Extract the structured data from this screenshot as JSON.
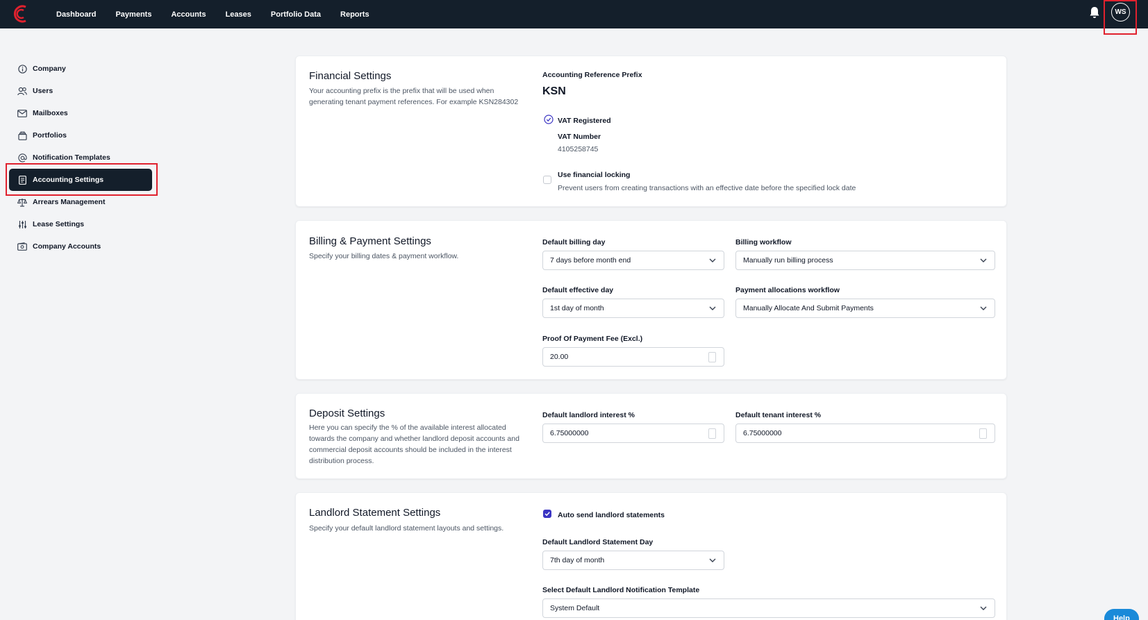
{
  "brand": {
    "accent": "#e0212e",
    "nav_bg": "#141f2b",
    "checkbox_color": "#3b35c3"
  },
  "topnav": {
    "items": [
      "Dashboard",
      "Payments",
      "Accounts",
      "Leases",
      "Portfolio Data",
      "Reports"
    ],
    "avatar_initials": "WS"
  },
  "sidebar": {
    "items": [
      {
        "label": "Company",
        "icon": "info-circle-icon"
      },
      {
        "label": "Users",
        "icon": "users-icon"
      },
      {
        "label": "Mailboxes",
        "icon": "mail-icon"
      },
      {
        "label": "Portfolios",
        "icon": "portfolio-icon"
      },
      {
        "label": "Notification Templates",
        "icon": "at-sign-icon"
      },
      {
        "label": "Accounting Settings",
        "icon": "document-icon",
        "active": true
      },
      {
        "label": "Arrears Management",
        "icon": "scale-icon"
      },
      {
        "label": "Lease Settings",
        "icon": "sliders-icon"
      },
      {
        "label": "Company Accounts",
        "icon": "wallet-icon"
      }
    ]
  },
  "financial": {
    "title": "Financial Settings",
    "description": "Your accounting prefix is the prefix that will be used when generating tenant payment references. For example KSN284302",
    "prefix_label": "Accounting Reference Prefix",
    "prefix_value": "KSN",
    "vat_registered_label": "VAT Registered",
    "vat_number_label": "VAT Number",
    "vat_number_value": "4105258745",
    "locking_label": "Use financial locking",
    "locking_desc": "Prevent users from creating transactions with an effective date before the specified lock date",
    "locking_checked": false
  },
  "billing": {
    "title": "Billing & Payment Settings",
    "description": "Specify your billing dates & payment workflow.",
    "billing_day_label": "Default billing day",
    "billing_day_value": "7 days before month end",
    "billing_workflow_label": "Billing workflow",
    "billing_workflow_value": "Manually run billing process",
    "effective_day_label": "Default effective day",
    "effective_day_value": "1st day of month",
    "alloc_workflow_label": "Payment allocations workflow",
    "alloc_workflow_value": "Manually Allocate And Submit Payments",
    "pop_fee_label": "Proof Of Payment Fee (Excl.)",
    "pop_fee_value": "20.00"
  },
  "deposit": {
    "title": "Deposit Settings",
    "description": "Here you can specify the % of the available interest allocated towards the company and whether landlord deposit accounts and commercial deposit accounts should be included in the interest distribution process.",
    "landlord_label": "Default landlord interest %",
    "landlord_value": "6.75000000",
    "tenant_label": "Default tenant interest %",
    "tenant_value": "6.75000000"
  },
  "landlord_statement": {
    "title": "Landlord Statement Settings",
    "description": "Specify your default landlord statement layouts and settings.",
    "auto_send_label": "Auto send landlord statements",
    "auto_send_checked": true,
    "statement_day_label": "Default Landlord Statement Day",
    "statement_day_value": "7th day of month",
    "template_label": "Select Default Landlord Notification Template",
    "template_value": "System Default"
  },
  "help_label": "Help"
}
